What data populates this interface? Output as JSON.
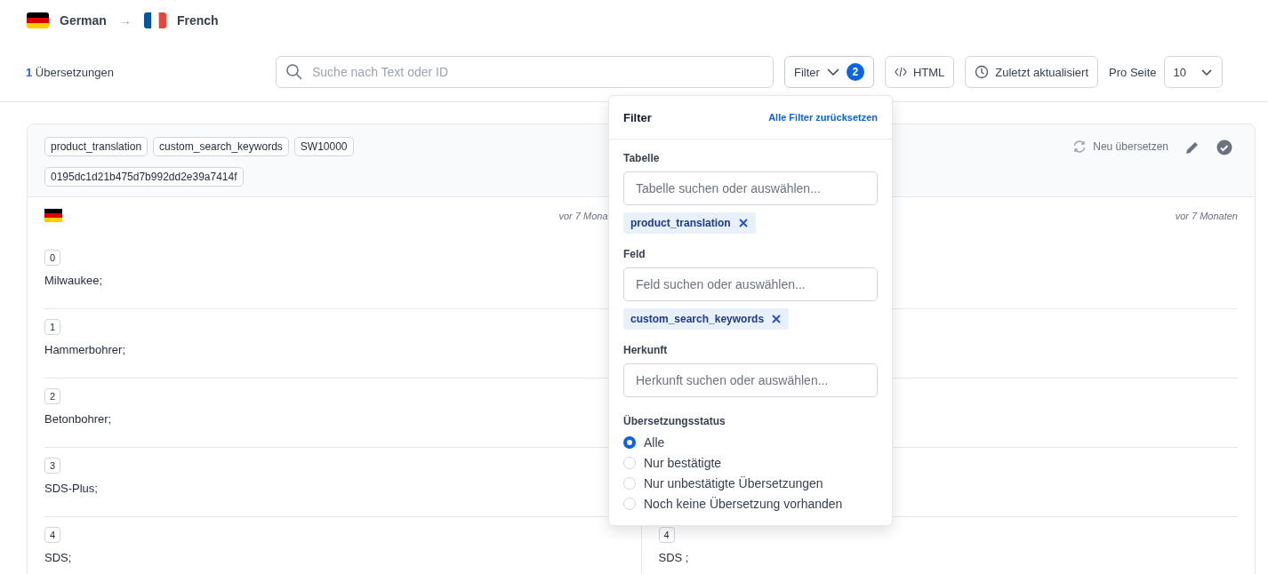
{
  "languages": {
    "source": {
      "kind": "de",
      "label": "German"
    },
    "arrow": "→",
    "target": {
      "kind": "fr",
      "label": "French"
    }
  },
  "toolbar": {
    "count": "1",
    "count_label": "Übersetzungen",
    "search": {
      "placeholder": "Suche nach Text oder ID"
    },
    "filter": {
      "label": "Filter",
      "badge": "2",
      "expanded": true
    },
    "html_button": "HTML",
    "sort_button": "Zuletzt aktualisiert",
    "per_page": {
      "label": "Pro Seite",
      "value": "10"
    }
  },
  "card": {
    "tags": [
      "product_translation",
      "custom_search_keywords",
      "SW10000",
      "0195dc1d21b475d7b992dd2e39a7414f"
    ],
    "actions": {
      "retranslate": "Neu übersetzen"
    },
    "source": {
      "time": "vor 7 Mona",
      "rows": [
        {
          "index": "0",
          "text": "Milwaukee;"
        },
        {
          "index": "1",
          "text": "Hammerbohrer;"
        },
        {
          "index": "2",
          "text": "Betonbohrer;"
        },
        {
          "index": "3",
          "text": "SDS-Plus;"
        },
        {
          "index": "4",
          "text": "SDS;"
        }
      ]
    },
    "target": {
      "time": "vor 7 Monaten",
      "rows": [
        {
          "index": "4",
          "text": "SDS ;"
        }
      ]
    }
  },
  "filter_panel": {
    "title": "Filter",
    "reset": "Alle Filter zurücksetzen",
    "sections": [
      {
        "label": "Tabelle",
        "placeholder": "Tabelle suchen oder auswählen...",
        "chips": [
          "product_translation"
        ]
      },
      {
        "label": "Feld",
        "placeholder": "Feld suchen oder auswählen...",
        "chips": [
          "custom_search_keywords"
        ]
      },
      {
        "label": "Herkunft",
        "placeholder": "Herkunft suchen oder auswählen..."
      }
    ],
    "status": {
      "label": "Übersetzungsstatus",
      "options": [
        {
          "label": "Alle",
          "selected": true
        },
        {
          "label": "Nur bestätigte",
          "selected": false
        },
        {
          "label": "Nur unbestätigte Übersetzungen",
          "selected": false
        },
        {
          "label": "Noch keine Übersetzung vorhanden",
          "selected": false
        }
      ]
    }
  }
}
